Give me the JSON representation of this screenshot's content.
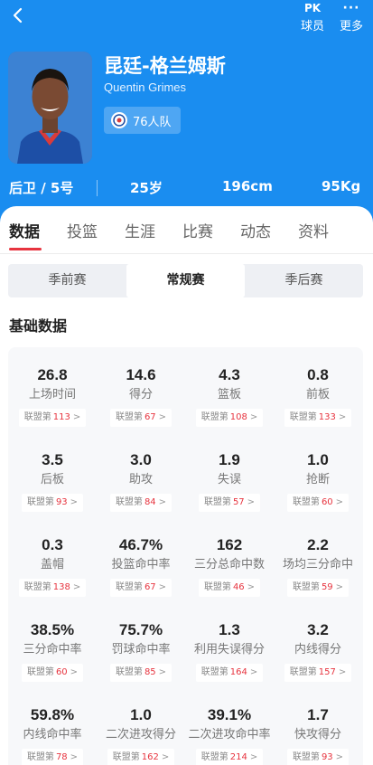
{
  "header": {
    "pk_icon_text": "PK",
    "pk_label": "球员",
    "more_label": "更多",
    "more_icon": "···"
  },
  "player": {
    "name_cn": "昆廷-格兰姆斯",
    "name_en": "Quentin Grimes",
    "team": "76人队",
    "position": "后卫 / 5号",
    "age": "25岁",
    "height": "196cm",
    "weight": "95Kg"
  },
  "tabs": [
    "数据",
    "投篮",
    "生涯",
    "比赛",
    "动态",
    "资料"
  ],
  "season_types": [
    "季前赛",
    "常规赛",
    "季后赛"
  ],
  "section_title": "基础数据",
  "rank_prefix": "联盟第",
  "stats": [
    {
      "value": "26.8",
      "label": "上场时间",
      "rank": "113"
    },
    {
      "value": "14.6",
      "label": "得分",
      "rank": "67"
    },
    {
      "value": "4.3",
      "label": "篮板",
      "rank": "108"
    },
    {
      "value": "0.8",
      "label": "前板",
      "rank": "133"
    },
    {
      "value": "3.5",
      "label": "后板",
      "rank": "93"
    },
    {
      "value": "3.0",
      "label": "助攻",
      "rank": "84"
    },
    {
      "value": "1.9",
      "label": "失误",
      "rank": "57"
    },
    {
      "value": "1.0",
      "label": "抢断",
      "rank": "60"
    },
    {
      "value": "0.3",
      "label": "盖帽",
      "rank": "138"
    },
    {
      "value": "46.7%",
      "label": "投篮命中率",
      "rank": "67"
    },
    {
      "value": "162",
      "label": "三分总命中数",
      "rank": "46"
    },
    {
      "value": "2.2",
      "label": "场均三分命中",
      "rank": "59"
    },
    {
      "value": "38.5%",
      "label": "三分命中率",
      "rank": "60"
    },
    {
      "value": "75.7%",
      "label": "罚球命中率",
      "rank": "85"
    },
    {
      "value": "1.3",
      "label": "利用失误得分",
      "rank": "164"
    },
    {
      "value": "3.2",
      "label": "内线得分",
      "rank": "157"
    },
    {
      "value": "59.8%",
      "label": "内线命中率",
      "rank": "78"
    },
    {
      "value": "1.0",
      "label": "二次进攻得分",
      "rank": "162"
    },
    {
      "value": "39.1%",
      "label": "二次进攻命中率",
      "rank": "214"
    },
    {
      "value": "1.7",
      "label": "快攻得分",
      "rank": "93"
    }
  ],
  "colors": {
    "header_bg": "#1a8df0",
    "accent_red": "#e7343f"
  }
}
